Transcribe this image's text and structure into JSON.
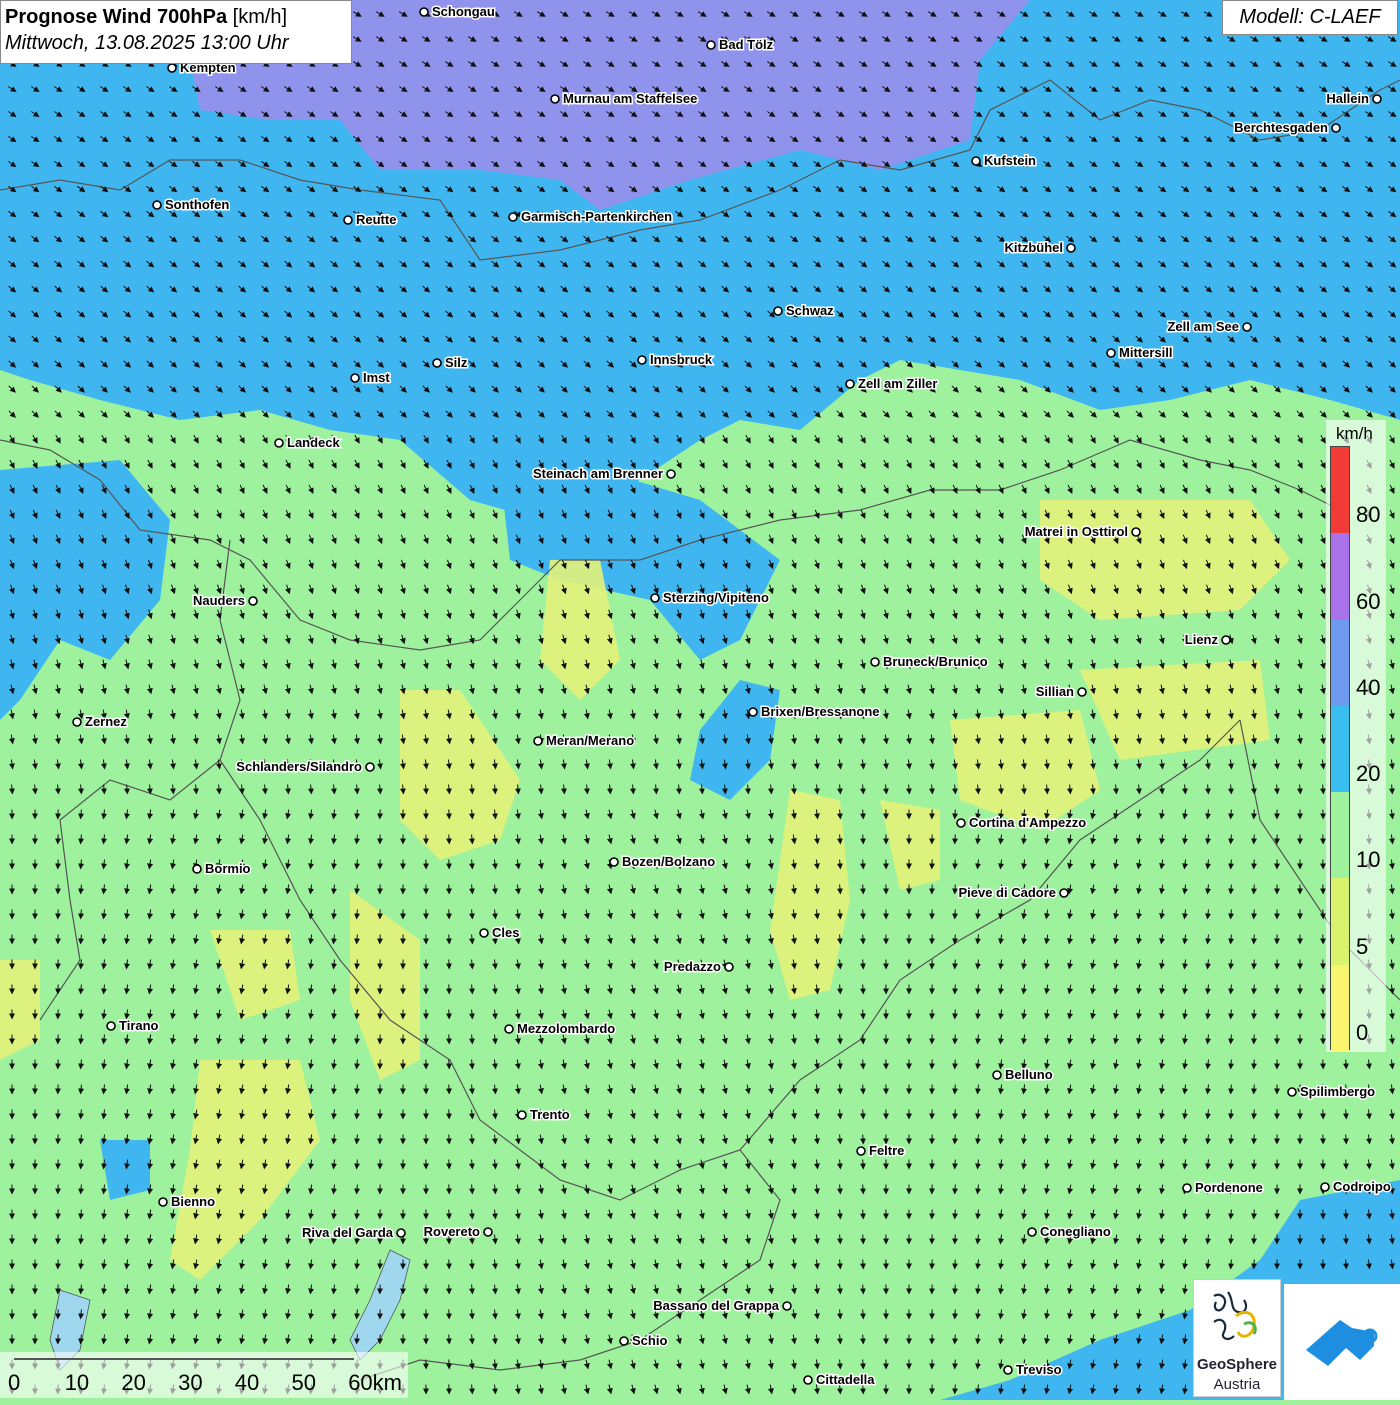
{
  "title": {
    "main": "Prognose Wind 700hPa",
    "unit": "[km/h]",
    "datetime": "Mittwoch, 13.08.2025 13:00 Uhr"
  },
  "model_label": "Modell: C-LAEF",
  "legend": {
    "unit": "km/h",
    "ticks": [
      "80",
      "60",
      "40",
      "20",
      "10",
      "5",
      "0"
    ],
    "colors": [
      "#f23a36",
      "#a873ea",
      "#6d99ee",
      "#38bff0",
      "#9ef29e",
      "#d9f36c",
      "#f9f56f"
    ]
  },
  "scale_bar": {
    "labels": [
      "0",
      "10",
      "20",
      "30",
      "40",
      "50",
      "60km"
    ]
  },
  "colors": {
    "calm": "#f5f27a",
    "light": "#9ef29e",
    "moderate": "#3fb6f0",
    "strong": "#8f93ec",
    "border": "#555555"
  },
  "cities": [
    {
      "name": "Schongau"
    },
    {
      "name": "Bad Tölz"
    },
    {
      "name": "Kempten"
    },
    {
      "name": "Murnau am Staffelsee"
    },
    {
      "name": "Hallein"
    },
    {
      "name": "Berchtesgaden"
    },
    {
      "name": "Kufstein"
    },
    {
      "name": "Sonthofen"
    },
    {
      "name": "Reutte"
    },
    {
      "name": "Garmisch-Partenkirchen"
    },
    {
      "name": "Kitzbühel"
    },
    {
      "name": "Schwaz"
    },
    {
      "name": "Zell am See"
    },
    {
      "name": "Innsbruck"
    },
    {
      "name": "Mittersill"
    },
    {
      "name": "Silz"
    },
    {
      "name": "Imst"
    },
    {
      "name": "Zell am Ziller"
    },
    {
      "name": "Landeck"
    },
    {
      "name": "Steinach am Brenner"
    },
    {
      "name": "Matrei in Osttirol"
    },
    {
      "name": "Nauders"
    },
    {
      "name": "Sterzing/Vipiteno"
    },
    {
      "name": "Lienz"
    },
    {
      "name": "Bruneck/Brunico"
    },
    {
      "name": "Sillian"
    },
    {
      "name": "Zernez"
    },
    {
      "name": "Brixen/Bressanone"
    },
    {
      "name": "Meran/Merano"
    },
    {
      "name": "Schlanders/Silandro"
    },
    {
      "name": "Cortina d'Ampezzo"
    },
    {
      "name": "Bormio"
    },
    {
      "name": "Bozen/Bolzano"
    },
    {
      "name": "Pieve di Cadore"
    },
    {
      "name": "Cles"
    },
    {
      "name": "Predazzo"
    },
    {
      "name": "Tirano"
    },
    {
      "name": "Mezzolombardo"
    },
    {
      "name": "Belluno"
    },
    {
      "name": "Spilimbergo"
    },
    {
      "name": "Trento"
    },
    {
      "name": "Feltre"
    },
    {
      "name": "Pordenone"
    },
    {
      "name": "Codroipo"
    },
    {
      "name": "Bienno"
    },
    {
      "name": "Riva del Garda"
    },
    {
      "name": "Rovereto"
    },
    {
      "name": "Conegliano"
    },
    {
      "name": "Bassano del Grappa"
    },
    {
      "name": "Schio"
    },
    {
      "name": "Treviso"
    },
    {
      "name": "Cittadella"
    }
  ],
  "logo": {
    "name": "GeoSphere",
    "sub": "Austria"
  }
}
